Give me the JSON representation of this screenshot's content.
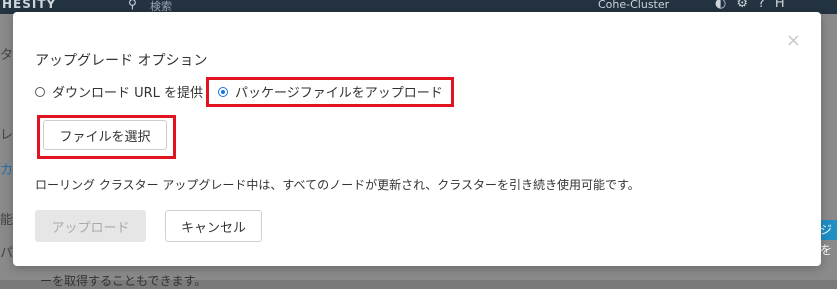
{
  "background": {
    "logo": "HESITY",
    "search_placeholder": "検索",
    "cluster_name": "Cohe-Cluster",
    "left_fragments": [
      "タ",
      "レ",
      "カ/",
      "能",
      "パ"
    ],
    "right_button": "ジを",
    "bottom_text": "ーを取得することもできます。"
  },
  "modal": {
    "title": "アップグレード オプション",
    "close_icon": "×",
    "radio_options": [
      {
        "label": "ダウンロード URL を提供",
        "checked": false
      },
      {
        "label": "パッケージファイルをアップロード",
        "checked": true
      }
    ],
    "choose_file_label": "ファイルを選択",
    "description": "ローリング クラスター アップグレード中は、すべてのノードが更新され、クラスターを引き続き使用可能です。",
    "upload_label": "アップロード",
    "cancel_label": "キャンセル"
  },
  "colors": {
    "highlight": "#e0141e",
    "radio_accent": "#1a73e8",
    "topbar": "#243342"
  }
}
